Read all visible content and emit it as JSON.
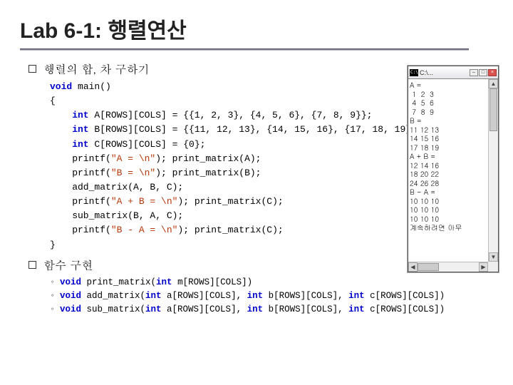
{
  "title": "Lab 6-1: 행렬연산",
  "bullets": {
    "b1": "행렬의 합, 차 구하기",
    "b2": "함수 구현"
  },
  "code": {
    "l0": "void main()",
    "l1": "{",
    "l2a": "    int",
    "l2b": " A[ROWS][COLS] = {{1, 2, 3}, {4, 5, 6}, {7, 8, 9}};",
    "l3a": "    int",
    "l3b": " B[ROWS][COLS] = {{11, 12, 13}, {14, 15, 16}, {17, 18, 19}};",
    "l4a": "    int",
    "l4b": " C[ROWS][COLS] = {0};",
    "l5a": "    printf(",
    "l5s": "\"A = \\n\"",
    "l5b": "); print_matrix(A);",
    "l6a": "    printf(",
    "l6s": "\"B = \\n\"",
    "l6b": "); print_matrix(B);",
    "l7": "    add_matrix(A, B, C);",
    "l8a": "    printf(",
    "l8s": "\"A + B = \\n\"",
    "l8b": "); print_matrix(C);",
    "l9": "    sub_matrix(B, A, C);",
    "l10a": "    printf(",
    "l10s": "\"B - A = \\n\"",
    "l10b": "); print_matrix(C);",
    "l11": "}"
  },
  "sigs": {
    "s1_kw1": "void",
    "s1_a": " print_matrix(",
    "s1_kw2": "int",
    "s1_b": " m[ROWS][COLS])",
    "s2_kw1": "void",
    "s2_a": " add_matrix(",
    "s2_kw2": "int",
    "s2_b": " a[ROWS][COLS], ",
    "s2_kw3": "int",
    "s2_c": " b[ROWS][COLS], ",
    "s2_kw4": "int",
    "s2_d": " c[ROWS][COLS])",
    "s3_kw1": "void",
    "s3_a": " sub_matrix(",
    "s3_kw2": "int",
    "s3_b": " a[ROWS][COLS], ",
    "s3_kw3": "int",
    "s3_c": " b[ROWS][COLS], ",
    "s3_kw4": "int",
    "s3_d": " c[ROWS][COLS])"
  },
  "sig_bullet": "◦",
  "console": {
    "title": "C:\\...",
    "output": "A =\n 1  2  3\n 4  5  6\n 7  8  9\nB =\n11 12 13\n14 15 16\n17 18 19\nA + B =\n12 14 16\n18 20 22\n24 26 28\nB - A =\n10 10 10\n10 10 10\n10 10 10\n계속하려면 아무"
  }
}
